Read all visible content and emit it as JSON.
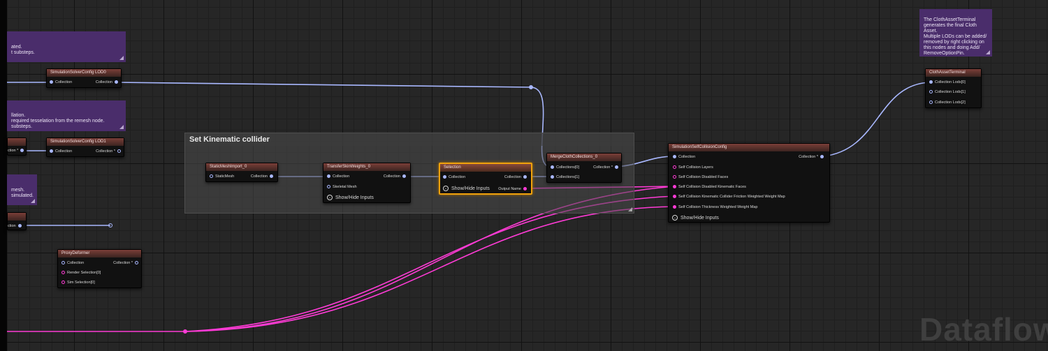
{
  "comments": {
    "c1": "ated.\nt substeps.",
    "c2": "llation.\nrequired tesselation from the remesh node.\nsubsteps.",
    "c3": "mesh.\nsimulated.",
    "cloth_terminal_note": "The ClothAssetTerminal generates the final Cloth Asset.\nMultiple LODs can be added/ removed by right clicking on this nodes and doing Add/ RemoveOptionPin."
  },
  "group": {
    "title": "Set Kinematic collider"
  },
  "nodes": {
    "solver_lod0": {
      "title": "SimulationSolverConfig LOD0",
      "in": "Collection",
      "out": "Collection"
    },
    "solver_lod1": {
      "title": "SimulationSolverConfig LOD1",
      "in": "Collection",
      "out": "Collection *"
    },
    "left_partial_a": {
      "out": "ction *"
    },
    "left_partial_b": {
      "out": "ction"
    },
    "proxy_deformer": {
      "title": "ProxyDeformer",
      "in": "Collection",
      "out": "Collection *",
      "render_sel": "Render Selection[0]",
      "sim_sel": "Sim Selection[0]"
    },
    "static_mesh_import": {
      "title": "StaticMeshImport_0",
      "in": "StaticMesh",
      "out": "Collection"
    },
    "transfer_skin": {
      "title": "TransferSkinWeights_0",
      "in": "Collection",
      "out": "Collection",
      "skeletal": "Skeletal Mesh",
      "show_hide": "Show/Hide Inputs"
    },
    "selection": {
      "title": "Selection",
      "in": "Collection",
      "out": "Collection",
      "show_hide": "Show/Hide Inputs",
      "output_name": "Output Name"
    },
    "merge": {
      "title": "MergeClothCollections_0",
      "in0": "Collections[0]",
      "in1": "Collections[1]",
      "out": "Collection *"
    },
    "self_collision": {
      "title": "SimulationSelfCollisionConfig",
      "in": "Collection",
      "out": "Collection *",
      "layers": "Self Collision Layers",
      "disabled_faces": "Self Collision Disabled Faces",
      "disabled_kin_faces": "Self Collision Disabled Kinematic Faces",
      "friction_map": "Self Collision Kinematic Collider Friction Weighted Weight Map",
      "thickness_map": "Self Collision Thickness Weighted Weight Map",
      "show_hide": "Show/Hide Inputs"
    },
    "cloth_terminal": {
      "title": "ClothAssetTerminal",
      "lod0": "Collection Lods[0]",
      "lod1": "Collection Lods[1]",
      "lod2": "Collection Lods[2]"
    }
  },
  "watermark": "Dataflow"
}
